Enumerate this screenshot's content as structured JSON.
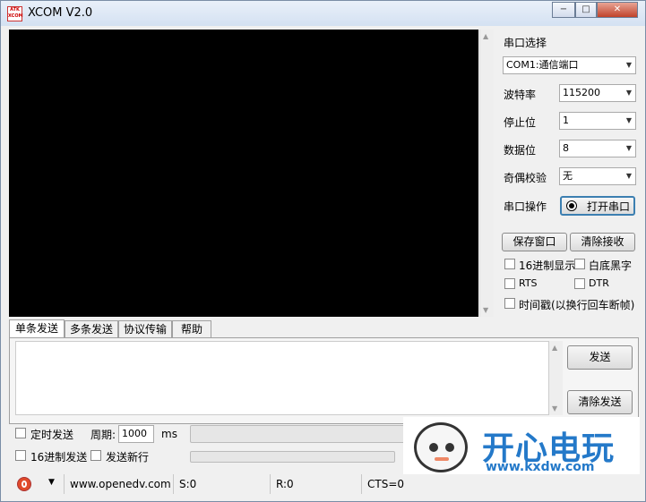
{
  "window": {
    "title": "XCOM V2.0",
    "icon_text": "ATK XCOM",
    "minimize": "−",
    "maximize": "□",
    "close": "✕"
  },
  "settings": {
    "port_label": "串口选择",
    "port_value": "COM1:通信端口",
    "baud_label": "波特率",
    "baud_value": "115200",
    "stop_label": "停止位",
    "stop_value": "1",
    "data_label": "数据位",
    "data_value": "8",
    "parity_label": "奇偶校验",
    "parity_value": "无",
    "op_label": "串口操作",
    "open_button": "打开串口",
    "save_button": "保存窗口",
    "clear_recv_button": "清除接收",
    "hex_display": "16进制显示",
    "white_bg": "白底黑字",
    "rts": "RTS",
    "dtr": "DTR",
    "timestamp": "时间戳(以换行回车断帧)"
  },
  "tabs": [
    {
      "label": "单条发送"
    },
    {
      "label": "多条发送"
    },
    {
      "label": "协议传输"
    },
    {
      "label": "帮助"
    }
  ],
  "send": {
    "send_button": "发送",
    "clear_send_button": "清除发送",
    "timed_send": "定时发送",
    "period_label": "周期:",
    "period_value": "1000",
    "period_unit": "ms",
    "hex_send": "16进制发送",
    "send_newline": "发送新行"
  },
  "status": {
    "url": "www.openedv.com",
    "sent": "S:0",
    "received": "R:0",
    "cts": "CTS=0"
  },
  "watermark": {
    "text": "开心电玩",
    "url": "www.kxdw.com"
  }
}
